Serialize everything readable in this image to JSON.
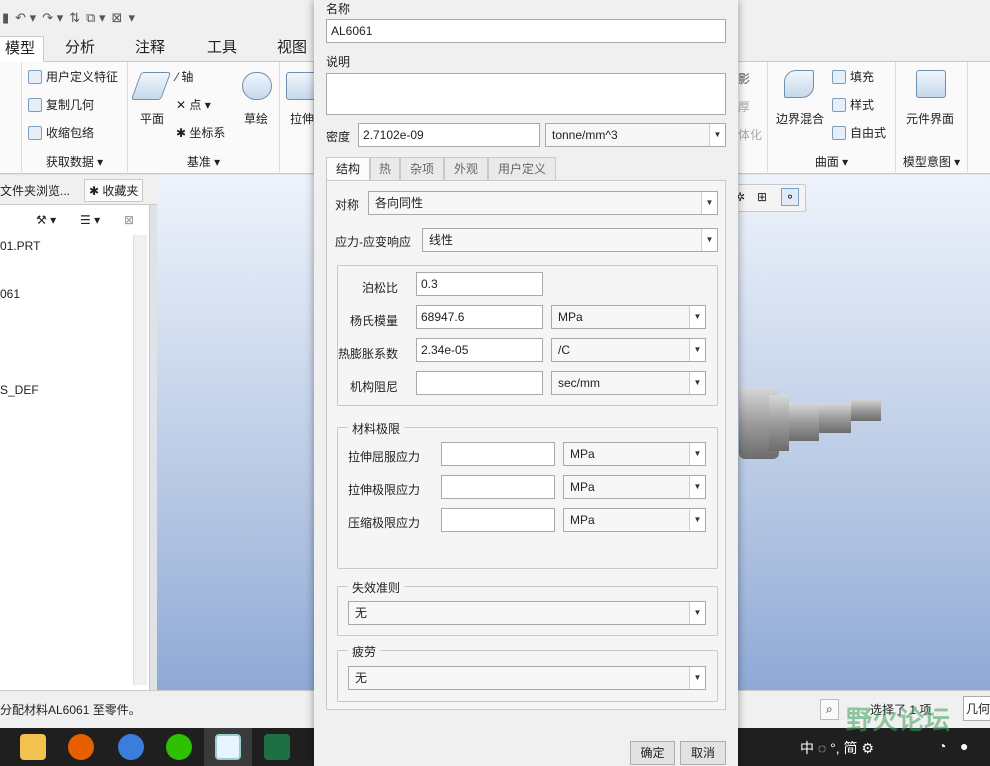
{
  "app": {
    "tabs": [
      "模型",
      "分析",
      "注释",
      "工具",
      "视图"
    ],
    "groups": {
      "get_data": {
        "label": "获取数据",
        "items": [
          "用户定义特征",
          "复制几何",
          "收缩包络"
        ]
      },
      "datum": {
        "label": "基准",
        "plane": "平面",
        "items": [
          "轴",
          "点",
          "坐标系"
        ],
        "sketch": "草绘"
      },
      "extrude_label": "拉伸",
      "surfaces": {
        "label": "曲面",
        "boundary_blend": "边界混合",
        "items": [
          "填充",
          "样式",
          "自由式"
        ]
      },
      "model_intent": {
        "label": "模型意图",
        "component_interface": "元件界面"
      },
      "partial_right": [
        "影",
        "厚",
        "体化"
      ]
    },
    "nav": {
      "tabs": [
        "文件夹浏览...",
        "收藏夹"
      ],
      "items": [
        "01.PRT",
        "061",
        "S_DEF"
      ]
    },
    "status": {
      "message": "分配材料AL6061 至零件。",
      "selection": "选择了 1 项",
      "filter": "几何"
    },
    "ime": {
      "text": "中 ◌ °, 简 ⚙"
    },
    "watermark": "野火论坛"
  },
  "dialog": {
    "name_label": "名称",
    "name_value": "AL6061",
    "desc_label": "说明",
    "desc_value": "",
    "density_label": "密度",
    "density_value": "2.7102e-09",
    "density_unit": "tonne/mm^3",
    "tabs": [
      "结构",
      "热",
      "杂项",
      "外观",
      "用户定义"
    ],
    "symmetry_label": "对称",
    "symmetry_value": "各向同性",
    "stress_strain_label": "应力-应变响应",
    "stress_strain_value": "线性",
    "props": [
      {
        "label": "泊松比",
        "value": "0.3",
        "unit": ""
      },
      {
        "label": "杨氏模量",
        "value": "68947.6",
        "unit": "MPa"
      },
      {
        "label": "热膨胀系数",
        "value": "2.34e-05",
        "unit": "/C"
      },
      {
        "label": "机构阻尼",
        "value": "",
        "unit": "sec/mm"
      }
    ],
    "limits": {
      "title": "材料极限",
      "rows": [
        {
          "label": "拉伸屈服应力",
          "value": "",
          "unit": "MPa"
        },
        {
          "label": "拉伸极限应力",
          "value": "",
          "unit": "MPa"
        },
        {
          "label": "压缩极限应力",
          "value": "",
          "unit": "MPa"
        }
      ]
    },
    "failure": {
      "title": "失效准则",
      "value": "无"
    },
    "fatigue": {
      "title": "疲劳",
      "value": "无"
    },
    "ok_label": "确定",
    "cancel_label": "取消"
  }
}
